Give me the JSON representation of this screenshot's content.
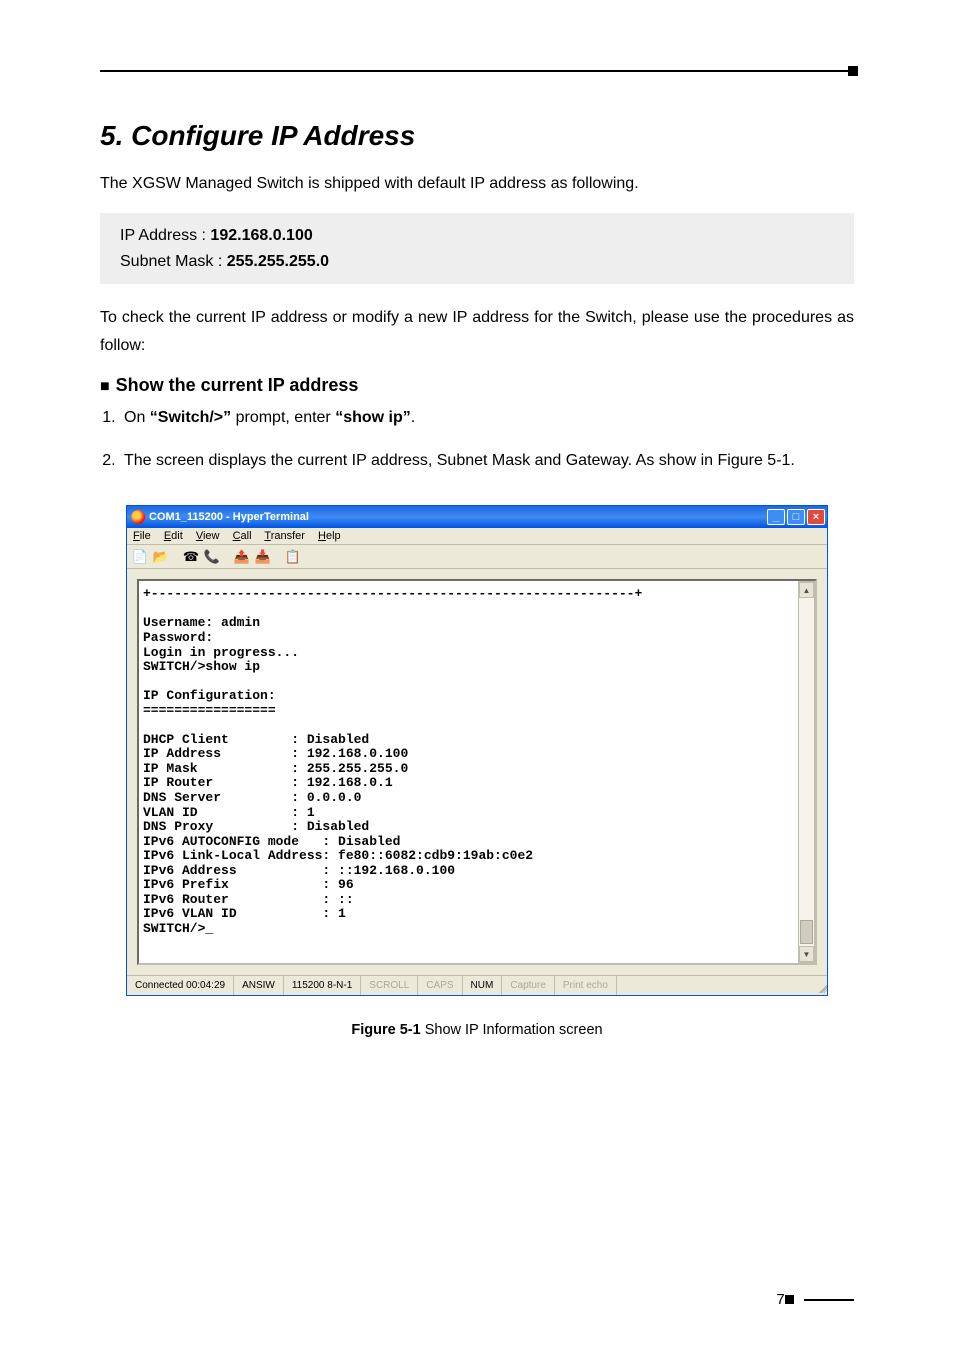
{
  "heading": "5. Configure IP Address",
  "intro": "The XGSW Managed Switch is shipped with default IP address as following.",
  "defaults": {
    "ip_label": "IP Address : ",
    "ip_value": "192.168.0.100",
    "mask_label": "Subnet Mask : ",
    "mask_value": "255.255.255.0"
  },
  "para2a": "To check the current IP address or modify a new IP address for the Switch, please",
  "para2b": "use the procedures as follow:",
  "sub1": "Show the current IP address",
  "step1_a": "On ",
  "step1_b": "“Switch/>”",
  "step1_c": " prompt, enter ",
  "step1_d": "“show ip”",
  "step1_e": ".",
  "step2_a": "The screen displays the current IP address, Subnet Mask and Gateway. As show in Figure 5-1.",
  "hyperterminal": {
    "title": "COM1_115200 - HyperTerminal",
    "menus": {
      "file": "File",
      "edit": "Edit",
      "view": "View",
      "call": "Call",
      "transfer": "Transfer",
      "help": "Help"
    },
    "terminal": "+--------------------------------------------------------------+\n\nUsername: admin\nPassword:\nLogin in progress...\nSWITCH/>show ip\n\nIP Configuration:\n=================\n\nDHCP Client        : Disabled\nIP Address         : 192.168.0.100\nIP Mask            : 255.255.255.0\nIP Router          : 192.168.0.1\nDNS Server         : 0.0.0.0\nVLAN ID            : 1\nDNS Proxy          : Disabled\nIPv6 AUTOCONFIG mode   : Disabled\nIPv6 Link-Local Address: fe80::6082:cdb9:19ab:c0e2\nIPv6 Address           : ::192.168.0.100\nIPv6 Prefix            : 96\nIPv6 Router            : ::\nIPv6 VLAN ID           : 1\nSWITCH/>_",
    "status": {
      "connected": "Connected 00:04:29",
      "emulation": "ANSIW",
      "port": "115200 8-N-1",
      "scroll": "SCROLL",
      "caps": "CAPS",
      "num": "NUM",
      "capture": "Capture",
      "printecho": "Print echo"
    }
  },
  "figure_bold": "Figure 5-1",
  "figure_rest": "  Show IP Information screen",
  "page": "7"
}
